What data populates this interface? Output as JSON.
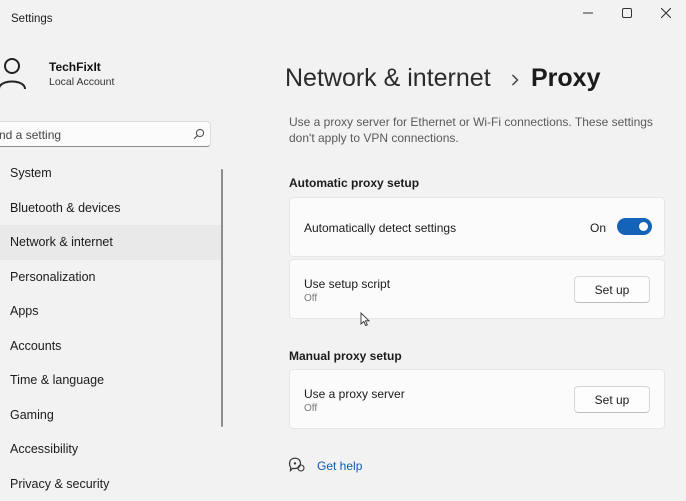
{
  "window": {
    "title": "Settings",
    "controls": {
      "minimize": "minimize-icon",
      "maximize": "maximize-icon",
      "close": "close-icon"
    }
  },
  "user": {
    "name": "TechFixIt",
    "account_type": "Local Account",
    "icon": "person-icon"
  },
  "search": {
    "text": "nd a setting",
    "icon": "search-icon"
  },
  "sidebar": {
    "items": [
      {
        "label": "System"
      },
      {
        "label": "Bluetooth & devices"
      },
      {
        "label": "Network & internet",
        "selected": true
      },
      {
        "label": "Personalization"
      },
      {
        "label": "Apps"
      },
      {
        "label": "Accounts"
      },
      {
        "label": "Time & language"
      },
      {
        "label": "Gaming"
      },
      {
        "label": "Accessibility"
      },
      {
        "label": "Privacy & security"
      }
    ]
  },
  "header": {
    "parent": "Network & internet",
    "current": "Proxy"
  },
  "description": "Use a proxy server for Ethernet or Wi-Fi connections. These settings don't apply to VPN connections.",
  "automatic": {
    "title": "Automatic proxy setup",
    "detect": {
      "label": "Automatically detect settings",
      "state": "On",
      "enabled": true
    },
    "script": {
      "label": "Use setup script",
      "status": "Off",
      "button": "Set up"
    }
  },
  "manual": {
    "title": "Manual proxy setup",
    "server": {
      "label": "Use a proxy server",
      "status": "Off",
      "button": "Set up"
    }
  },
  "help": {
    "label": "Get help",
    "icon": "help-icon"
  },
  "colors": {
    "accent": "#1463b8",
    "link": "#0b5bb5",
    "background": "#f2f2f3",
    "card": "#fbfbfb"
  }
}
